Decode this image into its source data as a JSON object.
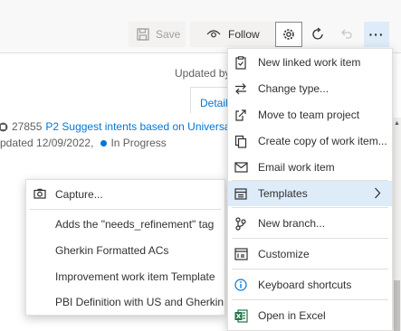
{
  "toolbar": {
    "save_label": "Save",
    "follow_label": "Follow",
    "more_label": "···"
  },
  "header": {
    "updated_by": "Updated by",
    "details_tab": "Detail"
  },
  "parent": {
    "id": "27855",
    "title": "P2 Suggest intents based on Universal",
    "updated": "pdated 12/09/2022,",
    "state": "In Progress",
    "state_color": "#0078d4"
  },
  "submenu": {
    "items": [
      {
        "label": "Capture...",
        "icon": "camera-icon"
      },
      {
        "label": "Adds the \"needs_refinement\" tag"
      },
      {
        "label": "Gherkin Formatted ACs"
      },
      {
        "label": "Improvement work item Template"
      },
      {
        "label": "PBI Definition with US and Gherkin"
      }
    ]
  },
  "menu": {
    "items": [
      {
        "label": "New linked work item",
        "icon": "linked-work-item-icon"
      },
      {
        "label": "Change type...",
        "icon": "change-type-icon"
      },
      {
        "label": "Move to team project",
        "icon": "move-project-icon"
      },
      {
        "label": "Create copy of work item...",
        "icon": "copy-icon"
      },
      {
        "label": "Email work item",
        "icon": "email-icon"
      },
      {
        "label": "Templates",
        "icon": "templates-icon",
        "active": true
      },
      {
        "label": "New branch...",
        "icon": "branch-icon"
      },
      {
        "label": "Customize",
        "icon": "customize-icon"
      },
      {
        "label": "Keyboard shortcuts",
        "icon": "info-icon"
      },
      {
        "label": "Open in Excel",
        "icon": "excel-icon"
      }
    ]
  },
  "colors": {
    "accent": "#0078d4",
    "menu_active_bg": "#deecf9",
    "excel_green": "#217346"
  }
}
